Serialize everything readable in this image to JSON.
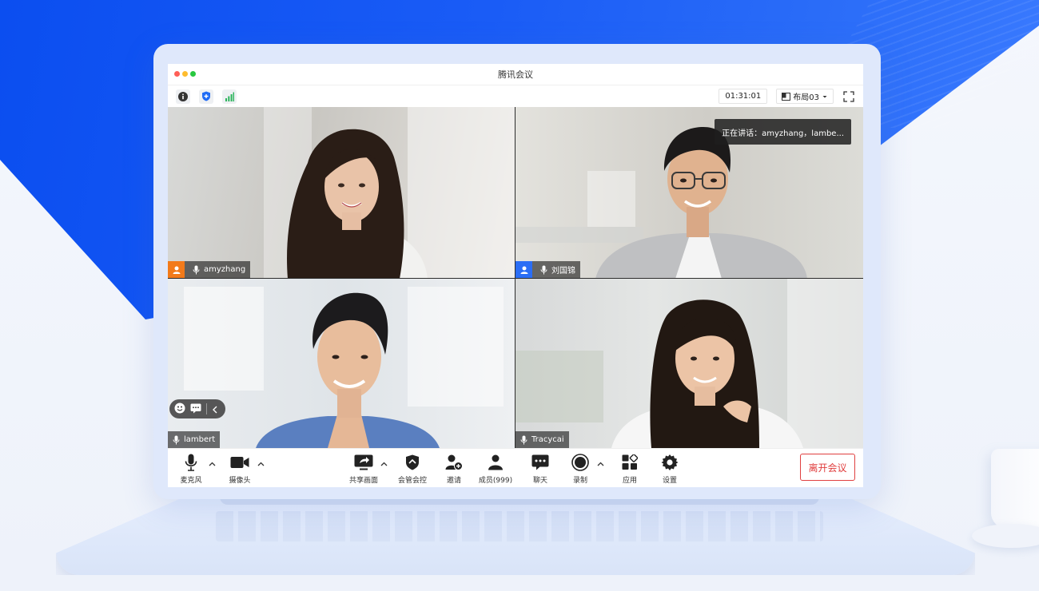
{
  "app": {
    "title": "腾讯会议"
  },
  "window_controls": {
    "colors": [
      "#ff5f57",
      "#febc2e",
      "#28c840"
    ]
  },
  "infobar": {
    "info_icon": "info-icon",
    "security_icon": "shield-icon",
    "signal_icon": "signal-icon",
    "timer": "01:31:01",
    "layout_label": "布局03",
    "fullscreen_icon": "fullscreen-icon"
  },
  "participants": [
    {
      "name": "amyzhang",
      "host": true,
      "host_color": "#f27a1a",
      "mic": "on"
    },
    {
      "name": "刘国锦",
      "host": true,
      "host_color": "#2b6ef5",
      "mic": "on",
      "speaking_banner": "正在讲话：amyzhang，lambe..."
    },
    {
      "name": "lambert",
      "host": false,
      "mic": "on"
    },
    {
      "name": "Tracycai",
      "host": false,
      "mic": "on"
    }
  ],
  "toolbar": {
    "mic": "麦克风",
    "camera": "摄像头",
    "share": "共享画面",
    "manage": "会管会控",
    "invite": "邀请",
    "members": "成员(999)",
    "chat": "聊天",
    "record": "录制",
    "apps": "应用",
    "settings": "设置",
    "leave": "离开会议"
  },
  "colors": {
    "brand_blue": "#1a5cf6",
    "leave_red": "#e03c3c",
    "signal_green": "#2db55d"
  }
}
